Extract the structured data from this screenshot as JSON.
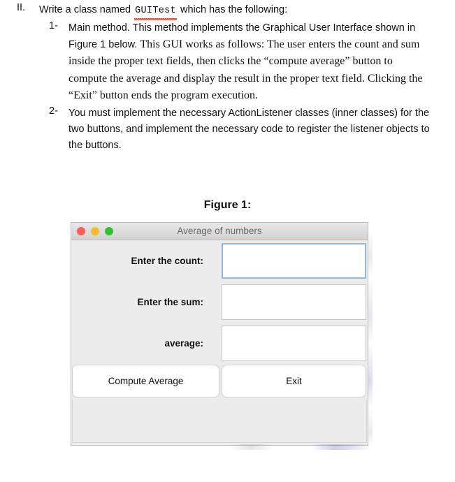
{
  "question": {
    "roman_marker": "II.",
    "lead_prefix": "Write a class named",
    "lead_class_name": "GUITest",
    "lead_suffix": "which has the following:",
    "items": [
      {
        "marker": "1-",
        "segments": [
          {
            "style": "sans",
            "text": "Main method. This method implements the Graphical User Interface shown in Figure 1 below. "
          },
          {
            "style": "serif",
            "text": "This GUI works as follows: The user enters the count and sum inside the proper text fields, then clicks the “compute average” button to compute the average and display the result in the proper text field. Clicking the “Exit” button ends the program execution."
          }
        ]
      },
      {
        "marker": "2-",
        "segments": [
          {
            "style": "sans",
            "text": "You must implement the necessary ActionListener classes (inner classes) for the two buttons, and implement the necessary code to register the listener objects to the buttons."
          }
        ]
      }
    ]
  },
  "figure": {
    "caption": "Figure 1:"
  },
  "mock_window": {
    "title": "Average of numbers",
    "traffic_lights": [
      {
        "name": "close",
        "color": "#fa5e55"
      },
      {
        "name": "minimize",
        "color": "#f6bd30"
      },
      {
        "name": "zoom",
        "color": "#2fc22f"
      }
    ],
    "rows": [
      {
        "label": "Enter the count:",
        "value": "",
        "placeholder": "",
        "focused": true
      },
      {
        "label": "Enter the sum:",
        "value": "",
        "placeholder": "",
        "focused": false
      },
      {
        "label": "average:",
        "value": "",
        "placeholder": "",
        "focused": false
      }
    ],
    "buttons": {
      "compute": "Compute Average",
      "exit": "Exit"
    }
  },
  "colors": {
    "window_background": "#ececec",
    "field_focus_border": "#8fbbe0",
    "field_border": "#c8c8c8",
    "title_text": "#6a6a6a",
    "spellcheck_underline": "#e03a2f"
  }
}
